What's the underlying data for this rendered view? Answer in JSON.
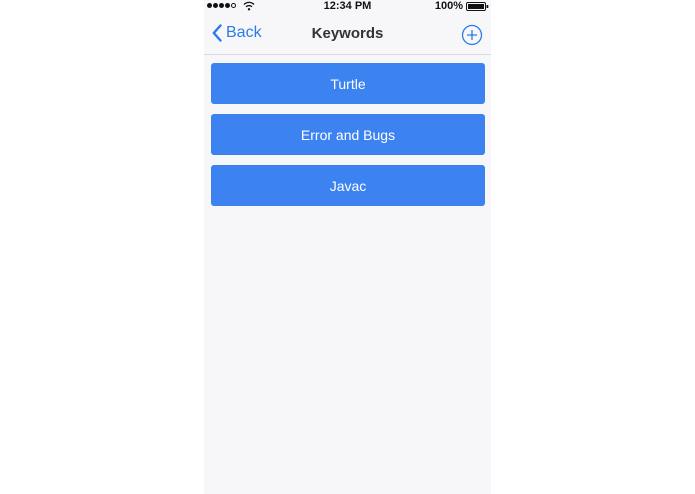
{
  "status_bar": {
    "time": "12:34 PM",
    "battery": "100%",
    "signal_icon": "signal-dots-icon",
    "wifi_icon": "wifi-icon",
    "battery_icon": "battery-icon"
  },
  "navbar": {
    "back_label": "Back",
    "title": "Keywords",
    "back_icon": "chevron-left-icon",
    "add_icon": "plus-circle-icon"
  },
  "keywords": [
    {
      "label": "Turtle"
    },
    {
      "label": "Error and Bugs"
    },
    {
      "label": "Javac"
    }
  ],
  "colors": {
    "accent": "#2a7be8",
    "button_bg": "#3c82f0",
    "background": "#f7f7fa"
  }
}
